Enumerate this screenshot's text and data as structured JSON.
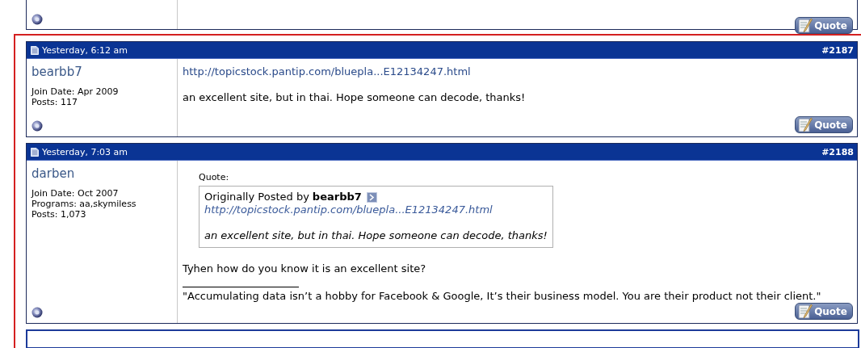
{
  "previous_post": {
    "quote_button": "Quote"
  },
  "posts": [
    {
      "date": "Yesterday, 6:12 am",
      "number": "#2187",
      "username": "bearbb7",
      "user_info": [
        "Join Date: Apr 2009",
        "Posts: 117"
      ],
      "body": [
        {
          "kind": "link",
          "text": "http://topicstock.pantip.com/bluepla...E12134247.html"
        },
        {
          "kind": "text",
          "text": "an excellent site, but in thai. Hope someone can decode, thanks!"
        }
      ],
      "quote_button": "Quote"
    },
    {
      "date": "Yesterday, 7:03 am",
      "number": "#2188",
      "username": "darben",
      "user_info": [
        "Join Date: Oct 2007",
        "Programs: aa,skymiless",
        "Posts: 1,073"
      ],
      "body": [
        {
          "kind": "quote",
          "label": "Quote:",
          "by": "Originally Posted by",
          "author": "bearbb7",
          "link": "http://topicstock.pantip.com/bluepla...E12134247.html",
          "text": "an excellent site, but in thai. Hope someone can decode, thanks!"
        },
        {
          "kind": "text",
          "text": "Tyhen how do you know it is an excellent site?"
        }
      ],
      "signature": "\"Accumulating data isn’t a hobby for Facebook & Google, It’s their business model. You are their product not their client.\"",
      "quote_button": "Quote"
    }
  ]
}
